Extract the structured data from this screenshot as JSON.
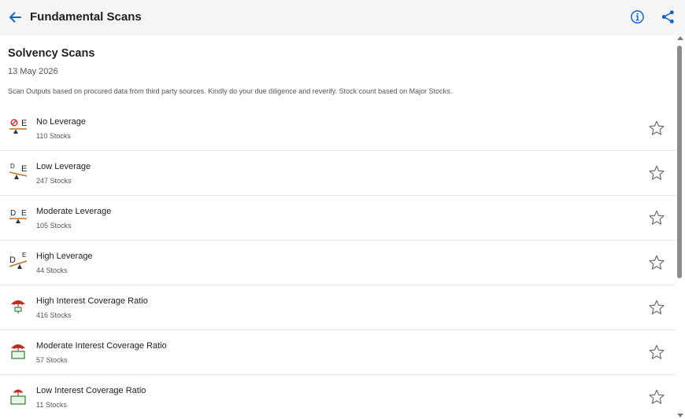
{
  "header": {
    "title": "Fundamental Scans",
    "back_icon": "arrow-left-icon",
    "info_icon": "info-icon",
    "share_icon": "share-icon",
    "accent_color": "#1565c0"
  },
  "section": {
    "title": "Solvency Scans",
    "date": "13 May 2026",
    "disclaimer": "Scan Outputs based on procured data from third party sources. Kindly do your due diligence and reverify. Stock count based on Major Stocks."
  },
  "scans": [
    {
      "name": "No Leverage",
      "count": "110 Stocks",
      "icon": "no-leverage-icon"
    },
    {
      "name": "Low Leverage",
      "count": "247 Stocks",
      "icon": "low-leverage-icon"
    },
    {
      "name": "Moderate Leverage",
      "count": "105 Stocks",
      "icon": "moderate-leverage-icon"
    },
    {
      "name": "High Leverage",
      "count": "44 Stocks",
      "icon": "high-leverage-icon"
    },
    {
      "name": "High Interest Coverage Ratio",
      "count": "416 Stocks",
      "icon": "umbrella-money-icon"
    },
    {
      "name": "Moderate Interest Coverage Ratio",
      "count": "57 Stocks",
      "icon": "umbrella-money-icon"
    },
    {
      "name": "Low Interest Coverage Ratio",
      "count": "11 Stocks",
      "icon": "umbrella-money-icon"
    }
  ],
  "icon_labels": {
    "debt": "D",
    "equity": "E"
  }
}
